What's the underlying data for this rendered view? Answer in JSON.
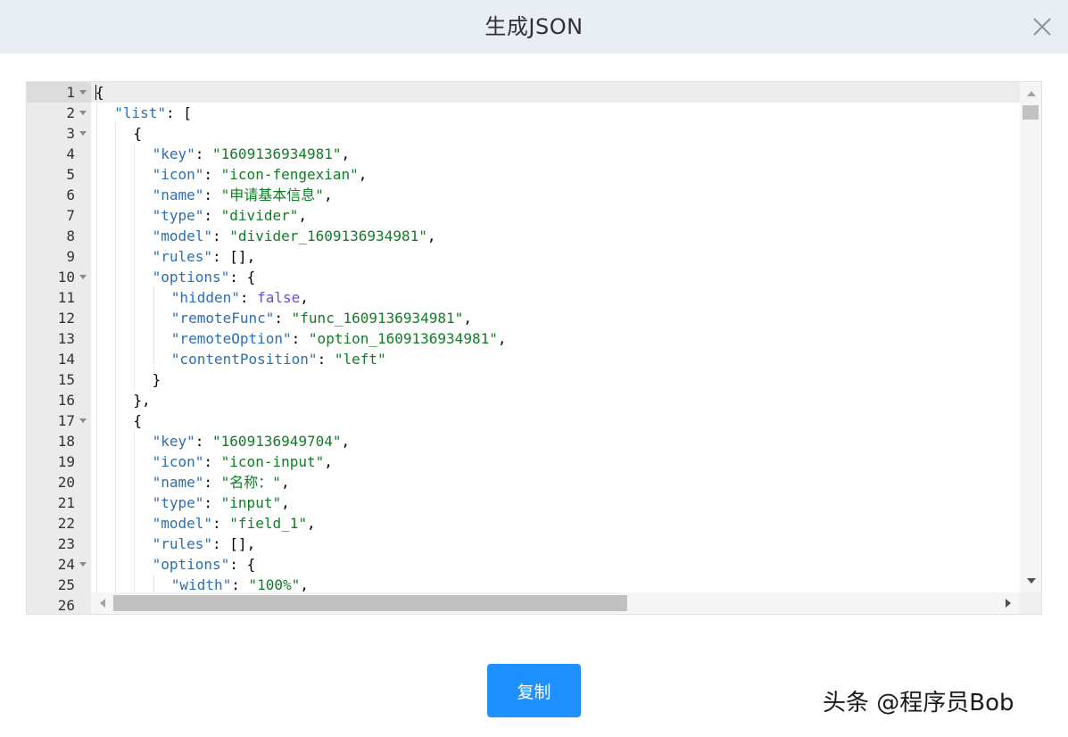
{
  "dialog": {
    "title": "生成JSON",
    "close_icon": "close-icon",
    "copy_label": "复制"
  },
  "watermark": "头条 @程序员Bob",
  "colors": {
    "header_bg": "#e9eef5",
    "button_bg": "#1e90ff",
    "json_key": "#2a6fb6",
    "json_string": "#0f7d25",
    "json_boolean": "#6a4fd1"
  },
  "editor": {
    "active_line": 1,
    "lines": [
      {
        "n": "1",
        "indent": 0,
        "fold": true,
        "tokens": [
          {
            "t": "{",
            "c": "punc"
          }
        ]
      },
      {
        "n": "2",
        "indent": 1,
        "fold": true,
        "tokens": [
          {
            "t": "\"list\"",
            "c": "key"
          },
          {
            "t": ": [",
            "c": "punc"
          }
        ]
      },
      {
        "n": "3",
        "indent": 2,
        "fold": true,
        "tokens": [
          {
            "t": "{",
            "c": "punc"
          }
        ]
      },
      {
        "n": "4",
        "indent": 3,
        "fold": false,
        "tokens": [
          {
            "t": "\"key\"",
            "c": "key"
          },
          {
            "t": ": ",
            "c": "punc"
          },
          {
            "t": "\"1609136934981\"",
            "c": "str"
          },
          {
            "t": ",",
            "c": "punc"
          }
        ]
      },
      {
        "n": "5",
        "indent": 3,
        "fold": false,
        "tokens": [
          {
            "t": "\"icon\"",
            "c": "key"
          },
          {
            "t": ": ",
            "c": "punc"
          },
          {
            "t": "\"icon-fengexian\"",
            "c": "str"
          },
          {
            "t": ",",
            "c": "punc"
          }
        ]
      },
      {
        "n": "6",
        "indent": 3,
        "fold": false,
        "tokens": [
          {
            "t": "\"name\"",
            "c": "key"
          },
          {
            "t": ": ",
            "c": "punc"
          },
          {
            "t": "\"申请基本信息\"",
            "c": "str"
          },
          {
            "t": ",",
            "c": "punc"
          }
        ]
      },
      {
        "n": "7",
        "indent": 3,
        "fold": false,
        "tokens": [
          {
            "t": "\"type\"",
            "c": "key"
          },
          {
            "t": ": ",
            "c": "punc"
          },
          {
            "t": "\"divider\"",
            "c": "str"
          },
          {
            "t": ",",
            "c": "punc"
          }
        ]
      },
      {
        "n": "8",
        "indent": 3,
        "fold": false,
        "tokens": [
          {
            "t": "\"model\"",
            "c": "key"
          },
          {
            "t": ": ",
            "c": "punc"
          },
          {
            "t": "\"divider_1609136934981\"",
            "c": "str"
          },
          {
            "t": ",",
            "c": "punc"
          }
        ]
      },
      {
        "n": "9",
        "indent": 3,
        "fold": false,
        "tokens": [
          {
            "t": "\"rules\"",
            "c": "key"
          },
          {
            "t": ": [],",
            "c": "punc"
          }
        ]
      },
      {
        "n": "10",
        "indent": 3,
        "fold": true,
        "tokens": [
          {
            "t": "\"options\"",
            "c": "key"
          },
          {
            "t": ": {",
            "c": "punc"
          }
        ]
      },
      {
        "n": "11",
        "indent": 4,
        "fold": false,
        "tokens": [
          {
            "t": "\"hidden\"",
            "c": "key"
          },
          {
            "t": ": ",
            "c": "punc"
          },
          {
            "t": "false",
            "c": "bool"
          },
          {
            "t": ",",
            "c": "punc"
          }
        ]
      },
      {
        "n": "12",
        "indent": 4,
        "fold": false,
        "tokens": [
          {
            "t": "\"remoteFunc\"",
            "c": "key"
          },
          {
            "t": ": ",
            "c": "punc"
          },
          {
            "t": "\"func_1609136934981\"",
            "c": "str"
          },
          {
            "t": ",",
            "c": "punc"
          }
        ]
      },
      {
        "n": "13",
        "indent": 4,
        "fold": false,
        "tokens": [
          {
            "t": "\"remoteOption\"",
            "c": "key"
          },
          {
            "t": ": ",
            "c": "punc"
          },
          {
            "t": "\"option_1609136934981\"",
            "c": "str"
          },
          {
            "t": ",",
            "c": "punc"
          }
        ]
      },
      {
        "n": "14",
        "indent": 4,
        "fold": false,
        "tokens": [
          {
            "t": "\"contentPosition\"",
            "c": "key"
          },
          {
            "t": ": ",
            "c": "punc"
          },
          {
            "t": "\"left\"",
            "c": "str"
          }
        ]
      },
      {
        "n": "15",
        "indent": 3,
        "fold": false,
        "tokens": [
          {
            "t": "}",
            "c": "punc"
          }
        ]
      },
      {
        "n": "16",
        "indent": 2,
        "fold": false,
        "tokens": [
          {
            "t": "},",
            "c": "punc"
          }
        ]
      },
      {
        "n": "17",
        "indent": 2,
        "fold": true,
        "tokens": [
          {
            "t": "{",
            "c": "punc"
          }
        ]
      },
      {
        "n": "18",
        "indent": 3,
        "fold": false,
        "tokens": [
          {
            "t": "\"key\"",
            "c": "key"
          },
          {
            "t": ": ",
            "c": "punc"
          },
          {
            "t": "\"1609136949704\"",
            "c": "str"
          },
          {
            "t": ",",
            "c": "punc"
          }
        ]
      },
      {
        "n": "19",
        "indent": 3,
        "fold": false,
        "tokens": [
          {
            "t": "\"icon\"",
            "c": "key"
          },
          {
            "t": ": ",
            "c": "punc"
          },
          {
            "t": "\"icon-input\"",
            "c": "str"
          },
          {
            "t": ",",
            "c": "punc"
          }
        ]
      },
      {
        "n": "20",
        "indent": 3,
        "fold": false,
        "tokens": [
          {
            "t": "\"name\"",
            "c": "key"
          },
          {
            "t": ": ",
            "c": "punc"
          },
          {
            "t": "\"名称：\"",
            "c": "str"
          },
          {
            "t": ",",
            "c": "punc"
          }
        ]
      },
      {
        "n": "21",
        "indent": 3,
        "fold": false,
        "tokens": [
          {
            "t": "\"type\"",
            "c": "key"
          },
          {
            "t": ": ",
            "c": "punc"
          },
          {
            "t": "\"input\"",
            "c": "str"
          },
          {
            "t": ",",
            "c": "punc"
          }
        ]
      },
      {
        "n": "22",
        "indent": 3,
        "fold": false,
        "tokens": [
          {
            "t": "\"model\"",
            "c": "key"
          },
          {
            "t": ": ",
            "c": "punc"
          },
          {
            "t": "\"field_1\"",
            "c": "str"
          },
          {
            "t": ",",
            "c": "punc"
          }
        ]
      },
      {
        "n": "23",
        "indent": 3,
        "fold": false,
        "tokens": [
          {
            "t": "\"rules\"",
            "c": "key"
          },
          {
            "t": ": [],",
            "c": "punc"
          }
        ]
      },
      {
        "n": "24",
        "indent": 3,
        "fold": true,
        "tokens": [
          {
            "t": "\"options\"",
            "c": "key"
          },
          {
            "t": ": {",
            "c": "punc"
          }
        ]
      },
      {
        "n": "25",
        "indent": 4,
        "fold": false,
        "tokens": [
          {
            "t": "\"width\"",
            "c": "key"
          },
          {
            "t": ": ",
            "c": "punc"
          },
          {
            "t": "\"100%\"",
            "c": "str"
          },
          {
            "t": ",",
            "c": "punc"
          }
        ]
      },
      {
        "n": "26",
        "indent": 4,
        "fold": false,
        "tokens": []
      }
    ]
  }
}
